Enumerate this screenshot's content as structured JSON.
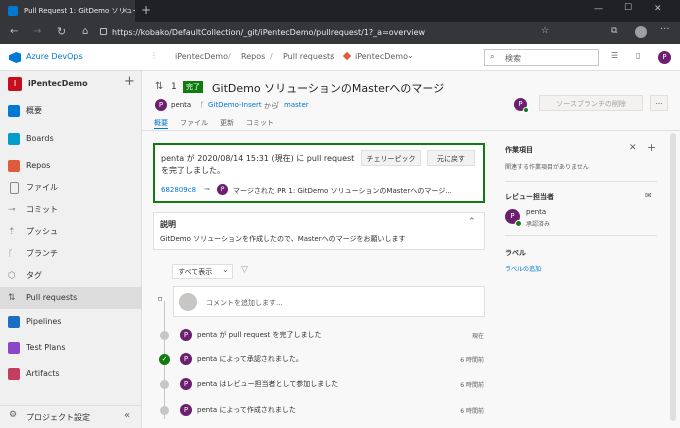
{
  "browser": {
    "tab_title": "Pull Request 1: GitDemo ソリュー...",
    "url": "https://kobako/DefaultCollection/_git/iPentecDemo/pullrequest/1?_a=overview",
    "new_tab": "+",
    "min": "—",
    "max": "☐",
    "close": "✕"
  },
  "header": {
    "logo": "Azure DevOps",
    "breadcrumb": [
      "iPentecDemo",
      "Repos",
      "Pull requests",
      "iPentecDemo"
    ],
    "search_placeholder": "検索",
    "avatar": "P"
  },
  "sidebar": {
    "project_initial": "I",
    "project_name": "iPentecDemo",
    "add": "+",
    "items": [
      {
        "label": "概要",
        "color": "#0078d4"
      },
      {
        "label": "Boards",
        "color": "#009ccc"
      },
      {
        "label": "Repos",
        "color": "#e05b3d"
      },
      {
        "label": "ファイル",
        "color": "#888"
      },
      {
        "label": "コミット",
        "color": "#888"
      },
      {
        "label": "プッシュ",
        "color": "#888"
      },
      {
        "label": "ブランチ",
        "color": "#888"
      },
      {
        "label": "タグ",
        "color": "#888"
      },
      {
        "label": "Pull requests",
        "color": "#888"
      },
      {
        "label": "Pipelines",
        "color": "#1d6fc5"
      },
      {
        "label": "Test Plans",
        "color": "#8b46c9"
      },
      {
        "label": "Artifacts",
        "color": "#c43d5e"
      }
    ],
    "settings": "プロジェクト設定",
    "collapse": "«"
  },
  "pr": {
    "id": "1",
    "status": "完了",
    "title": "GitDemo ソリューションのMasterへのマージ",
    "author": "penta",
    "source_branch": "GitDemo-Insert",
    "from": "から",
    "target_branch": "master",
    "delete_branch": "ソースブランチの削除",
    "more": "···",
    "tabs": [
      "概要",
      "ファイル",
      "更新",
      "コミット"
    ]
  },
  "completed": {
    "text_line1": "penta が 2020/08/14 15:31 (現在) に pull request",
    "text_line2": "を完了しました。",
    "cherry_pick": "チェリーピック",
    "revert": "元に戻す",
    "commit_id": "682809c8",
    "merge_message": "マージされた PR 1: GitDemo ソリューションのMasterへのマージ..."
  },
  "description": {
    "title": "説明",
    "text": "GitDemo ソリューションを作成したので、Masterへのマージをお願いします"
  },
  "activity": {
    "filter": "すべて表示",
    "comment_placeholder": "コメントを追加します...",
    "events": [
      {
        "text": "penta が pull request を完了しました",
        "time": "現在"
      },
      {
        "text": "penta によって承認されました。",
        "time": "6 時間前"
      },
      {
        "text": "penta はレビュー担当者として参加しました",
        "time": "6 時間前"
      },
      {
        "text": "penta によって作成されました",
        "time": "6 時間前"
      }
    ]
  },
  "right": {
    "work_items_title": "作業項目",
    "work_items_empty": "関連する作業項目がありません",
    "reviewers_title": "レビュー担当者",
    "reviewer_name": "penta",
    "reviewer_status": "承認済み",
    "labels_title": "ラベル",
    "add_label": "ラベルの追加"
  }
}
